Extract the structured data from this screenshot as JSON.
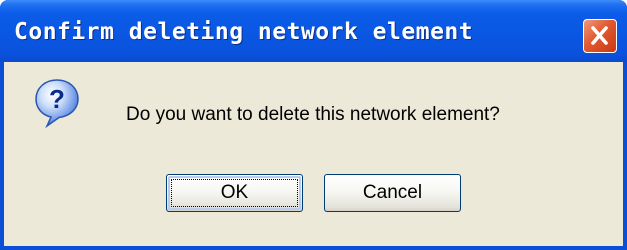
{
  "dialog": {
    "title": "Confirm deleting network element",
    "message": "Do you want to delete this network element?",
    "icon": "question-icon",
    "close_icon": "close-icon",
    "buttons": {
      "ok_label": "OK",
      "cancel_label": "Cancel"
    }
  },
  "colors": {
    "titlebar": "#0a57e3",
    "client_background": "#ece9d8",
    "close_button": "#e2582f",
    "button_border": "#003c74"
  }
}
